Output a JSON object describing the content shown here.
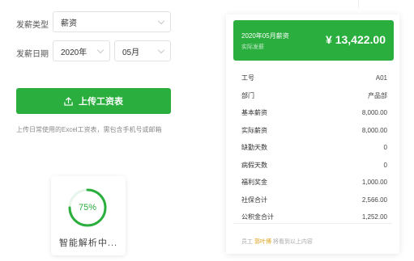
{
  "form": {
    "type_label": "发薪类型",
    "type_value": "薪资",
    "date_label": "发薪日期",
    "year_value": "2020年",
    "month_value": "05月"
  },
  "upload": {
    "button_label": "上传工资表",
    "hint": "上传日常使用的Excel工资表，需包含手机号或邮箱"
  },
  "parse": {
    "percent_text": "75%",
    "progress": 0.75,
    "status": "智能解析中..."
  },
  "slip": {
    "title": "2020年05月薪资",
    "subtitle": "实际发薪",
    "amount": "¥ 13,422.00",
    "rows": [
      {
        "label": "工号",
        "value": "A01"
      },
      {
        "label": "部门",
        "value": "产品部"
      },
      {
        "label": "基本薪资",
        "value": "8,000.00"
      },
      {
        "label": "实际薪资",
        "value": "8,000.00"
      },
      {
        "label": "缺勤天数",
        "value": "0"
      },
      {
        "label": "病假天数",
        "value": "0"
      },
      {
        "label": "福利奖金",
        "value": "1,000.00"
      },
      {
        "label": "社保合计",
        "value": "2,566.00"
      },
      {
        "label": "公积金合计",
        "value": "1,252.00"
      }
    ],
    "footer_prefix": "员工",
    "footer_highlight": "郭叶博",
    "footer_suffix": "将看到以上内容"
  },
  "colors": {
    "accent": "#2aae3e",
    "highlight": "#e0a21a"
  }
}
